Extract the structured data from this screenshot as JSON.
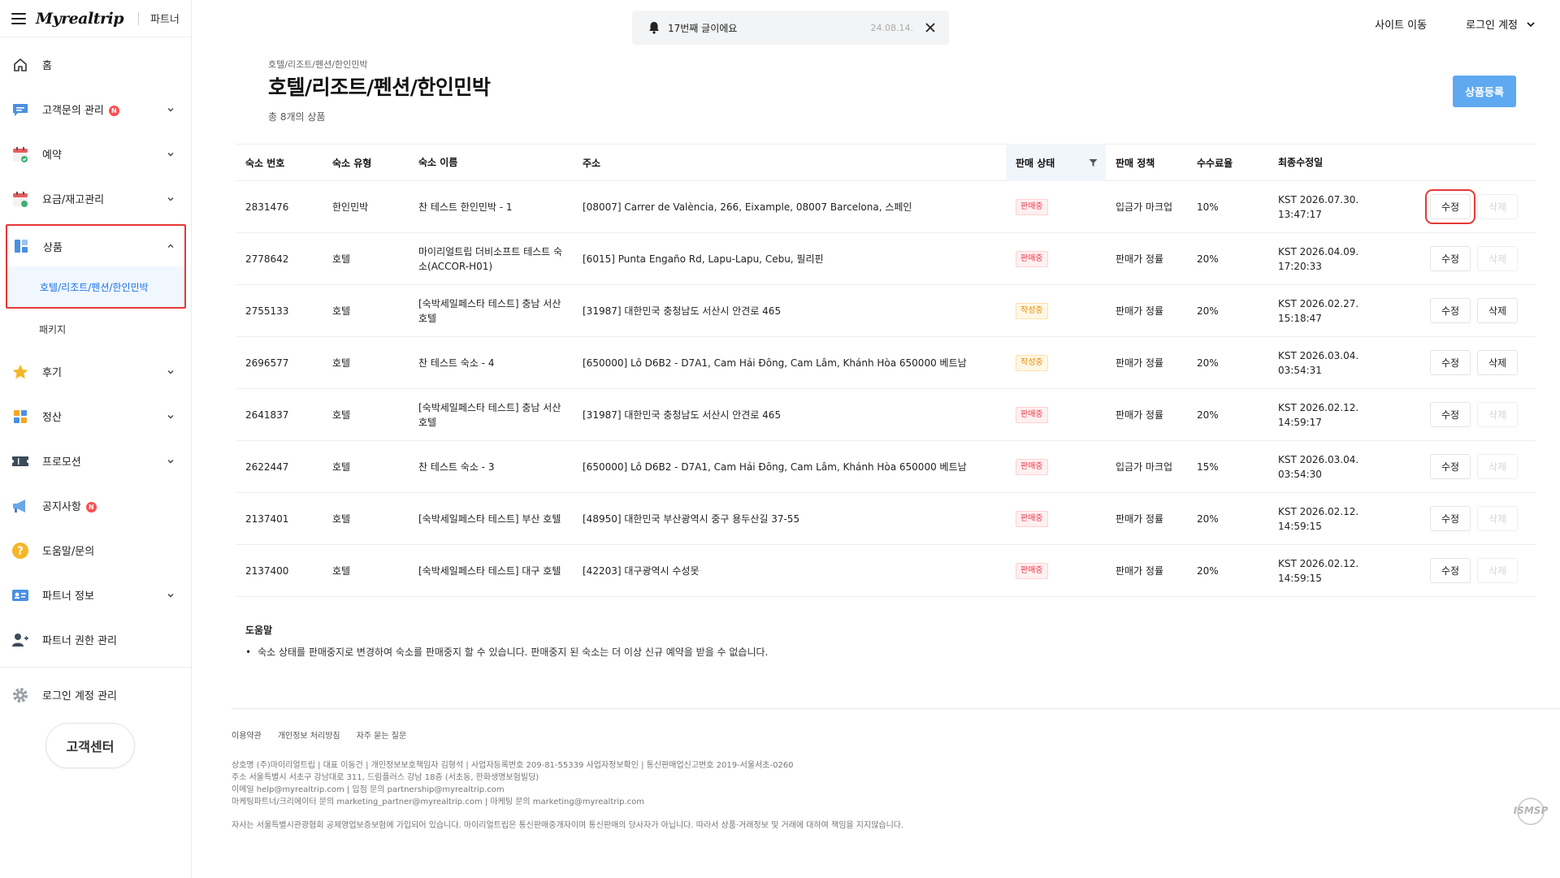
{
  "header": {
    "logo": "Myrealtrip",
    "partner_label": "파트너",
    "notice": {
      "text": "17번째 글이에요",
      "date": "24.08.14."
    },
    "site_move": "사이트 이동",
    "login_account": "로그인 계정"
  },
  "sidebar": {
    "items": [
      {
        "label": "홈",
        "icon": "home-icon"
      },
      {
        "label": "고객문의 관리",
        "icon": "chat-icon",
        "badge": "N"
      },
      {
        "label": "예약",
        "icon": "calendar-icon"
      },
      {
        "label": "요금/재고관리",
        "icon": "calendar-price-icon"
      },
      {
        "label": "상품",
        "icon": "grid-icon"
      },
      {
        "label": "호텔/리조트/펜션/한인민박"
      },
      {
        "label": "패키지"
      },
      {
        "label": "후기",
        "icon": "star-icon"
      },
      {
        "label": "정산",
        "icon": "settlement-icon"
      },
      {
        "label": "프로모션",
        "icon": "ticket-icon"
      },
      {
        "label": "공지사항",
        "icon": "megaphone-icon",
        "badge": "N"
      },
      {
        "label": "도움말/문의",
        "icon": "help-icon"
      },
      {
        "label": "파트너 정보",
        "icon": "id-card-icon"
      },
      {
        "label": "파트너 권한 관리",
        "icon": "user-add-icon"
      },
      {
        "label": "로그인 계정 관리",
        "icon": "gear-icon"
      }
    ],
    "cs_button": "고객센터"
  },
  "main": {
    "breadcrumb": "호텔/리조트/펜션/한인민박",
    "title": "호텔/리조트/펜션/한인민박",
    "count": "총 8개의 상품",
    "register_button": "상품등록",
    "columns": [
      "숙소 번호",
      "숙소 유형",
      "숙소 이름",
      "주소",
      "판매 상태",
      "판매 정책",
      "수수료율",
      "최종수정일"
    ],
    "edit_label": "수정",
    "delete_label": "삭제",
    "rows": [
      {
        "id": "2831476",
        "type": "한인민박",
        "name": "찬 테스트 한인민박 - 1",
        "address": "[08007] Carrer de València, 266, Eixample, 08007 Barcelona, 스페인",
        "status": "판매중",
        "status_kind": "sale",
        "policy": "입금가 마크업",
        "fee": "10%",
        "date1": "KST 2026.07.30.",
        "date2": "13:47:17",
        "delete_enabled": false
      },
      {
        "id": "2778642",
        "type": "호텔",
        "name": "마이리얼트립 더비소프트 테스트 숙소(ACCOR-H01)",
        "address": "[6015] Punta Engaño Rd, Lapu-Lapu, Cebu, 필리핀",
        "status": "판매중",
        "status_kind": "sale",
        "policy": "판매가 정률",
        "fee": "20%",
        "date1": "KST 2026.04.09.",
        "date2": "17:20:33",
        "delete_enabled": false
      },
      {
        "id": "2755133",
        "type": "호텔",
        "name": "[숙박세일페스타 테스트] 충남 서산 호텔",
        "address": "[31987] 대한민국 충청남도 서산시 안견로 465",
        "status": "작성중",
        "status_kind": "draft",
        "policy": "판매가 정률",
        "fee": "20%",
        "date1": "KST 2026.02.27.",
        "date2": "15:18:47",
        "delete_enabled": true
      },
      {
        "id": "2696577",
        "type": "호텔",
        "name": "찬 테스트 숙소 - 4",
        "address": "[650000] Lô D6B2 - D7A1, Cam Hải Đông, Cam Lâm, Khánh Hòa 650000 베트남",
        "status": "작성중",
        "status_kind": "draft",
        "policy": "판매가 정률",
        "fee": "20%",
        "date1": "KST 2026.03.04.",
        "date2": "03:54:31",
        "delete_enabled": true
      },
      {
        "id": "2641837",
        "type": "호텔",
        "name": "[숙박세일페스타 테스트] 충남 서산 호텔",
        "address": "[31987] 대한민국 충청남도 서산시 안견로 465",
        "status": "판매중",
        "status_kind": "sale",
        "policy": "판매가 정률",
        "fee": "20%",
        "date1": "KST 2026.02.12.",
        "date2": "14:59:17",
        "delete_enabled": false
      },
      {
        "id": "2622447",
        "type": "호텔",
        "name": "찬 테스트 숙소 - 3",
        "address": "[650000] Lô D6B2 - D7A1, Cam Hải Đông, Cam Lâm, Khánh Hòa 650000 베트남",
        "status": "판매중",
        "status_kind": "sale",
        "policy": "입금가 마크업",
        "fee": "15%",
        "date1": "KST 2026.03.04.",
        "date2": "03:54:30",
        "delete_enabled": false
      },
      {
        "id": "2137401",
        "type": "호텔",
        "name": "[숙박세일페스타 테스트] 부산 호텔",
        "address": "[48950] 대한민국 부산광역시 중구 용두산길 37-55",
        "status": "판매중",
        "status_kind": "sale",
        "policy": "판매가 정률",
        "fee": "20%",
        "date1": "KST 2026.02.12.",
        "date2": "14:59:15",
        "delete_enabled": false
      },
      {
        "id": "2137400",
        "type": "호텔",
        "name": "[숙박세일페스타 테스트] 대구 호텔",
        "address": "[42203] 대구광역시 수성못",
        "status": "판매중",
        "status_kind": "sale",
        "policy": "판매가 정률",
        "fee": "20%",
        "date1": "KST 2026.02.12.",
        "date2": "14:59:15",
        "delete_enabled": false
      }
    ],
    "help": {
      "title": "도움말",
      "item": "숙소 상태를 판매중지로 변경하여 숙소를 판매중지 할 수 있습니다. 판매중지 된 숙소는 더 이상 신규 예약을 받을 수 없습니다."
    }
  },
  "footer": {
    "links": [
      "이용약관",
      "개인정보 처리방침",
      "자주 묻는 질문"
    ],
    "info": [
      "상호명 (주)마이리얼트립 | 대표 이동건 | 개인정보보호책임자 김형석 | 사업자등록번호 209-81-55339 사업자정보확인 | 통신판매업신고번호 2019-서울서초-0260",
      "주소 서울특별시 서초구 강남대로 311, 드림플러스 강남 18층 (서초동, 한화생명보험빌딩)",
      "이메일 help@myrealtrip.com | 입점 문의 partnership@myrealtrip.com",
      "마케팅파트너/크리에이터 문의 marketing_partner@myrealtrip.com | 마케팅 문의 marketing@myrealtrip.com"
    ],
    "disclaimer": "자사는 서울특별시관광협회 공제영업보증보험에 가입되어 있습니다. 마이리얼트립은 통신판매중개자이며 통신판매의 당사자가 아닙니다. 따라서 상품·거래정보 및 거래에 대하여 책임을 지지않습니다.",
    "isms": "ISMSP"
  },
  "colors": {
    "accent": "#5ea9f0",
    "highlight": "#e53935",
    "sale": "#e53947",
    "draft": "#e98a00"
  }
}
